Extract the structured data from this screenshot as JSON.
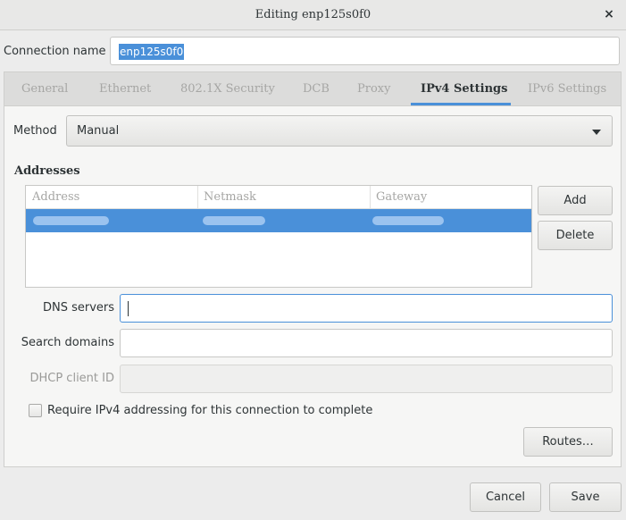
{
  "window": {
    "title": "Editing enp125s0f0",
    "close_glyph": "×"
  },
  "connection": {
    "label": "Connection name",
    "value": "enp125s0f0"
  },
  "tabs": [
    {
      "label": "General",
      "active": false
    },
    {
      "label": "Ethernet",
      "active": false
    },
    {
      "label": "802.1X Security",
      "active": false
    },
    {
      "label": "DCB",
      "active": false
    },
    {
      "label": "Proxy",
      "active": false
    },
    {
      "label": "IPv4 Settings",
      "active": true
    },
    {
      "label": "IPv6 Settings",
      "active": false
    }
  ],
  "method": {
    "label": "Method",
    "value": "Manual"
  },
  "addresses": {
    "heading": "Addresses",
    "columns": [
      "Address",
      "Netmask",
      "Gateway"
    ],
    "add_label": "Add",
    "delete_label": "Delete"
  },
  "fields": {
    "dns_label": "DNS servers",
    "dns_value": "",
    "search_label": "Search domains",
    "search_value": "",
    "dhcp_label": "DHCP client ID",
    "dhcp_value": ""
  },
  "require_ipv4": {
    "label": "Require IPv4 addressing for this connection to complete",
    "checked": false
  },
  "buttons": {
    "routes": "Routes…",
    "cancel": "Cancel",
    "save": "Save"
  },
  "colors": {
    "accent": "#4a90d9"
  }
}
